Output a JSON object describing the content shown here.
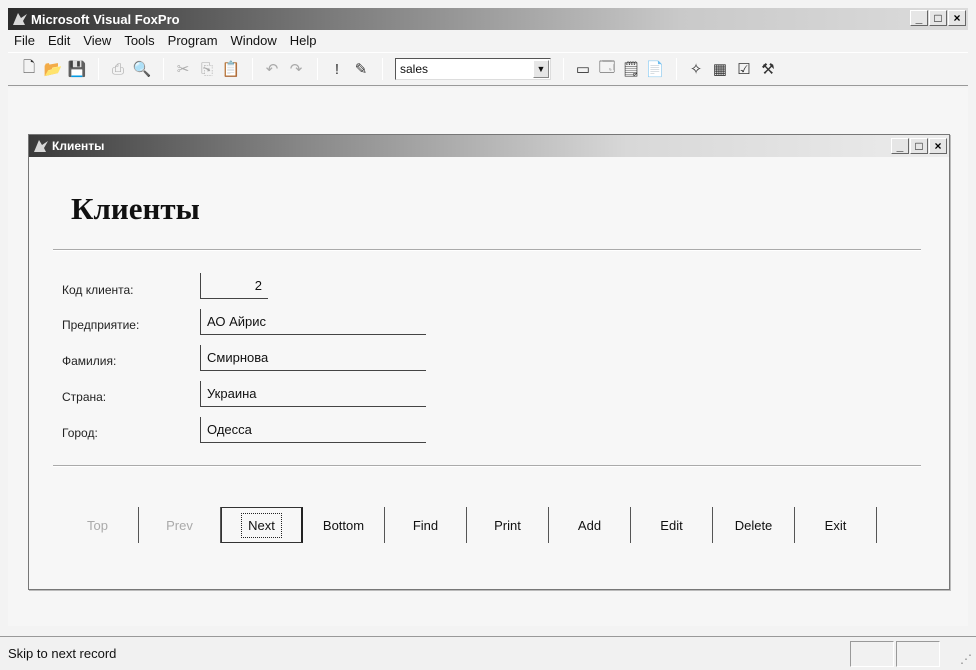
{
  "app": {
    "title": "Microsoft Visual FoxPro"
  },
  "menu": [
    "File",
    "Edit",
    "View",
    "Tools",
    "Program",
    "Window",
    "Help"
  ],
  "toolbar": {
    "combo_value": "sales"
  },
  "form": {
    "window_title": "Клиенты",
    "heading": "Клиенты",
    "fields": [
      {
        "label": "Код клиента:",
        "value": "2"
      },
      {
        "label": "Предприятие:",
        "value": "АО Айрис"
      },
      {
        "label": "Фамилия:",
        "value": "Смирнова"
      },
      {
        "label": "Страна:",
        "value": "Украина"
      },
      {
        "label": "Город:",
        "value": "Одесса"
      }
    ],
    "buttons": [
      "Top",
      "Prev",
      "Next",
      "Bottom",
      "Find",
      "Print",
      "Add",
      "Edit",
      "Delete",
      "Exit"
    ]
  },
  "status": {
    "text": "Skip to next record"
  }
}
